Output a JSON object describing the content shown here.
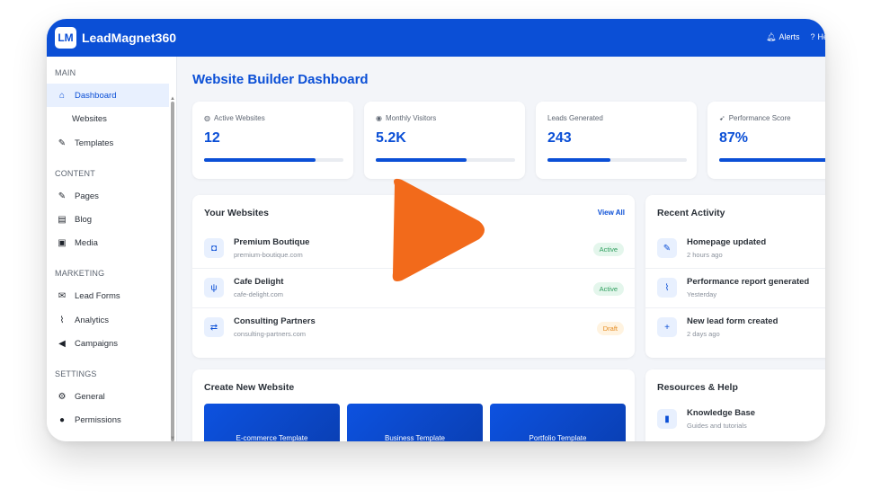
{
  "app": {
    "logo": "LM",
    "name": "LeadMagnet360"
  },
  "topbar": {
    "alerts_label": "Alerts",
    "help_label": "Help"
  },
  "sidebar": {
    "sections": [
      {
        "title": "MAIN"
      },
      {
        "title": "CONTENT"
      },
      {
        "title": "MARKETING"
      },
      {
        "title": "SETTINGS"
      }
    ],
    "items": [
      {
        "label": "Dashboard",
        "icon": "home-icon"
      },
      {
        "label": "Websites",
        "icon": ""
      },
      {
        "label": "Templates",
        "icon": "brush-icon"
      },
      {
        "label": "Pages",
        "icon": "edit-icon"
      },
      {
        "label": "Blog",
        "icon": "blog-icon"
      },
      {
        "label": "Media",
        "icon": "image-icon"
      },
      {
        "label": "Lead Forms",
        "icon": "envelope-icon"
      },
      {
        "label": "Analytics",
        "icon": "chart-line-icon"
      },
      {
        "label": "Campaigns",
        "icon": "bullhorn-icon"
      },
      {
        "label": "General",
        "icon": "gear-icon"
      },
      {
        "label": "Permissions",
        "icon": "users-icon"
      }
    ]
  },
  "main": {
    "title": "Website Builder Dashboard",
    "stats": [
      {
        "label": "Active Websites",
        "value": "12",
        "icon": "globe-icon",
        "progress": 0.8
      },
      {
        "label": "Monthly Visitors",
        "value": "5.2K",
        "icon": "eye-icon",
        "progress": 0.65
      },
      {
        "label": "Leads Generated",
        "value": "243",
        "icon": "",
        "progress": 0.45
      },
      {
        "label": "Performance Score",
        "value": "87%",
        "icon": "rocket-icon",
        "progress": 0.87
      }
    ],
    "websites": {
      "title": "Your Websites",
      "view_all": "View All",
      "items": [
        {
          "name": "Premium Boutique",
          "url": "premium-boutique.com",
          "status": "Active",
          "icon": "shopping-bag-icon"
        },
        {
          "name": "Cafe Delight",
          "url": "cafe-delight.com",
          "status": "Active",
          "icon": "utensils-icon"
        },
        {
          "name": "Consulting Partners",
          "url": "consulting-partners.com",
          "status": "Draft",
          "icon": "handshake-icon"
        }
      ]
    },
    "activity": {
      "title": "Recent Activity",
      "items": [
        {
          "text": "Homepage updated",
          "time": "2 hours ago",
          "icon": "edit-icon"
        },
        {
          "text": "Performance report generated",
          "time": "Yesterday",
          "icon": "chart-line-icon"
        },
        {
          "text": "New lead form created",
          "time": "2 days ago",
          "icon": "plus-icon"
        }
      ]
    },
    "create": {
      "title": "Create New Website",
      "templates": [
        "E-commerce Template",
        "Business Template",
        "Portfolio Template"
      ]
    },
    "resources": {
      "title": "Resources & Help",
      "items": [
        {
          "title": "Knowledge Base",
          "sub": "Guides and tutorials",
          "icon": "book-icon"
        }
      ]
    }
  },
  "colors": {
    "accent": "#0b4fd6",
    "play": "#f26a1b"
  }
}
